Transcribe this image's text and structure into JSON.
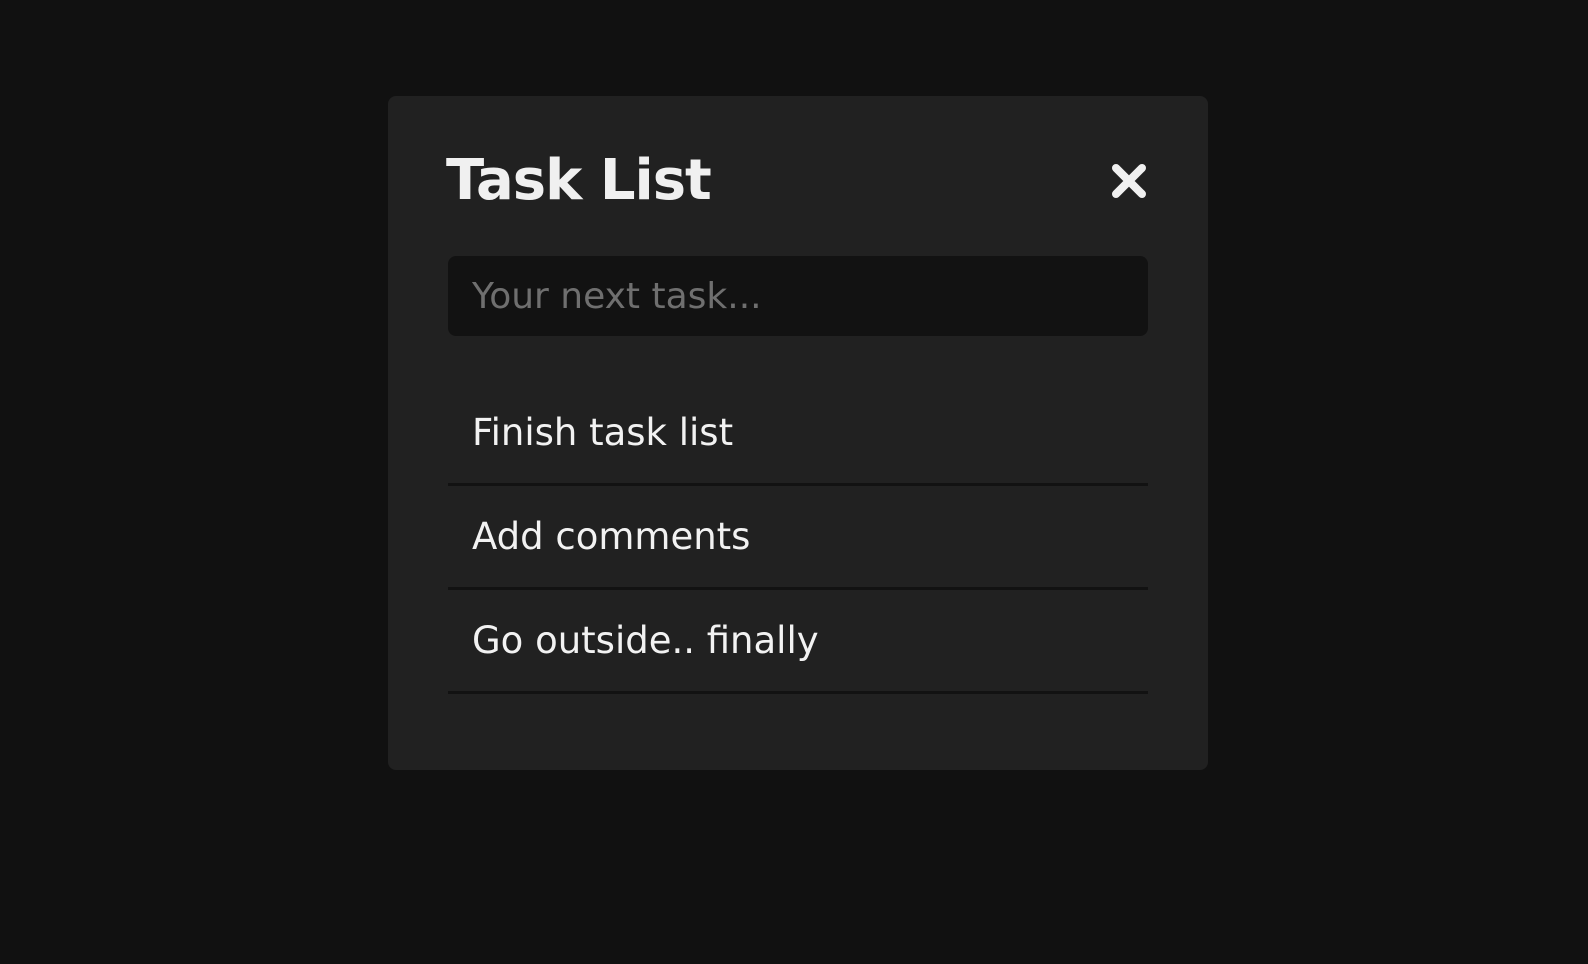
{
  "header": {
    "title": "Task List",
    "close_icon": "close-icon"
  },
  "input": {
    "placeholder": "Your next task...",
    "value": ""
  },
  "tasks": [
    {
      "label": "Finish task list"
    },
    {
      "label": "Add comments"
    },
    {
      "label": "Go outside.. finally"
    }
  ],
  "colors": {
    "background": "#111111",
    "card": "#212121",
    "input": "#121212",
    "text": "#f0f0f0"
  }
}
